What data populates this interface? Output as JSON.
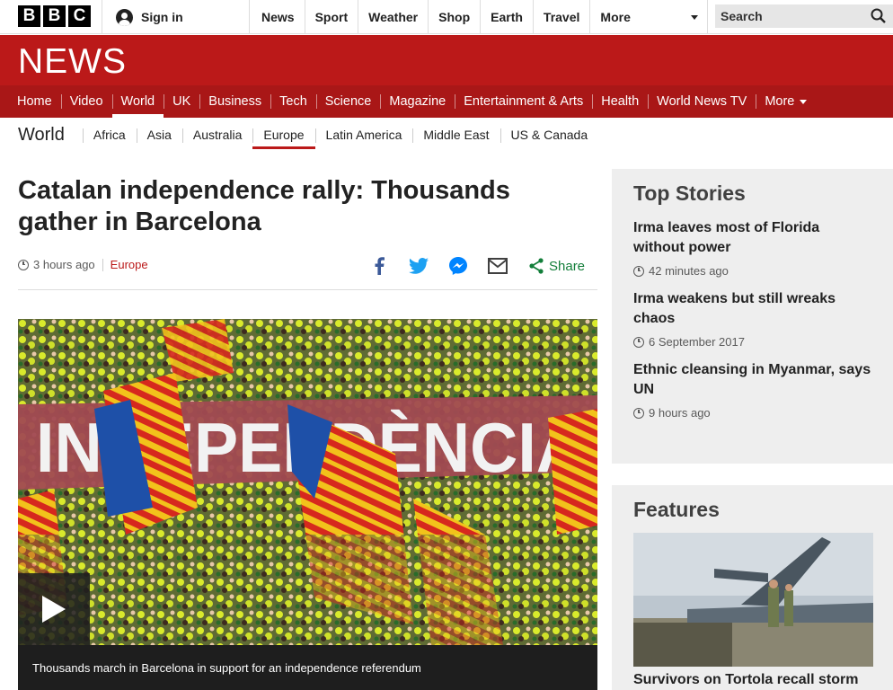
{
  "brand": {
    "letters": [
      "B",
      "B",
      "C"
    ],
    "wordmark": "NEWS"
  },
  "topbar": {
    "signin_label": "Sign in",
    "nav": [
      "News",
      "Sport",
      "Weather",
      "Shop",
      "Earth",
      "Travel"
    ],
    "more_label": "More",
    "search_label": "Search"
  },
  "section_nav": {
    "items": [
      "Home",
      "Video",
      "World",
      "UK",
      "Business",
      "Tech",
      "Science",
      "Magazine",
      "Entertainment & Arts",
      "Health",
      "World News TV"
    ],
    "more_label": "More",
    "active": "World"
  },
  "sub_nav": {
    "title": "World",
    "items": [
      "Africa",
      "Asia",
      "Australia",
      "Europe",
      "Latin America",
      "Middle East",
      "US & Canada"
    ],
    "active": "Europe"
  },
  "article": {
    "headline": "Catalan independence rally: Thousands gather in Barcelona",
    "time": "3 hours ago",
    "section": "Europe",
    "share_label": "Share",
    "media_banner_text": "INDEPENDÈNCIA",
    "caption": "Thousands march in Barcelona in support for an independence referendum"
  },
  "top_stories": {
    "title": "Top Stories",
    "items": [
      {
        "title": "Irma leaves most of Florida without power",
        "time": "42 minutes ago"
      },
      {
        "title": "Irma weakens but still wreaks chaos",
        "time": "6 September 2017"
      },
      {
        "title": "Ethnic cleansing in Myanmar, says UN",
        "time": "9 hours ago"
      }
    ]
  },
  "features": {
    "title": "Features",
    "items": [
      {
        "title": "Survivors on Tortola recall storm"
      }
    ]
  },
  "colors": {
    "brand_red": "#bb1919",
    "nav_red": "#a91717",
    "share_green": "#137e3a"
  }
}
